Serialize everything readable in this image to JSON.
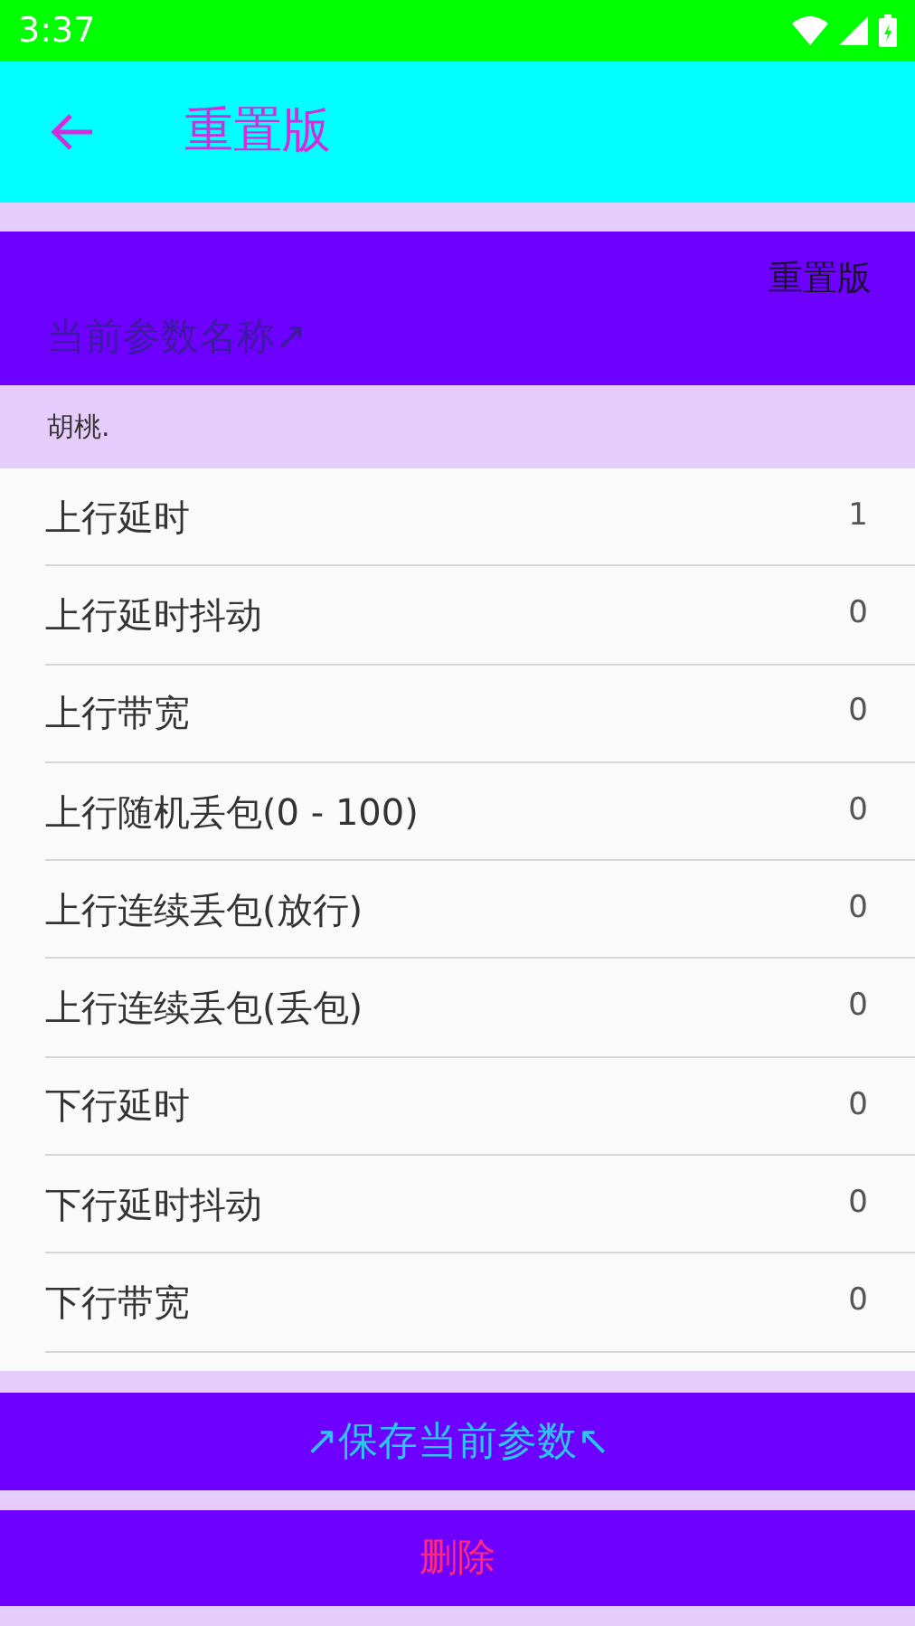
{
  "status_bar": {
    "time": "3:37"
  },
  "toolbar": {
    "title": "重置版"
  },
  "header": {
    "label": "重置版",
    "name_field": {
      "placeholder": "当前参数名称↗"
    }
  },
  "selected_preset": "胡桃.",
  "params": [
    {
      "label": "上行延时",
      "value": "1"
    },
    {
      "label": "上行延时抖动",
      "value": "0"
    },
    {
      "label": "上行带宽",
      "value": "0"
    },
    {
      "label": "上行随机丢包(0 - 100)",
      "value": "0"
    },
    {
      "label": "上行连续丢包(放行)",
      "value": "0"
    },
    {
      "label": "上行连续丢包(丢包)",
      "value": "0"
    },
    {
      "label": "下行延时",
      "value": "0"
    },
    {
      "label": "下行延时抖动",
      "value": "0"
    },
    {
      "label": "下行带宽",
      "value": "0"
    }
  ],
  "buttons": [
    {
      "kind": "save",
      "label": "↗保存当前参数↖"
    },
    {
      "kind": "delete",
      "label": "删除"
    }
  ]
}
